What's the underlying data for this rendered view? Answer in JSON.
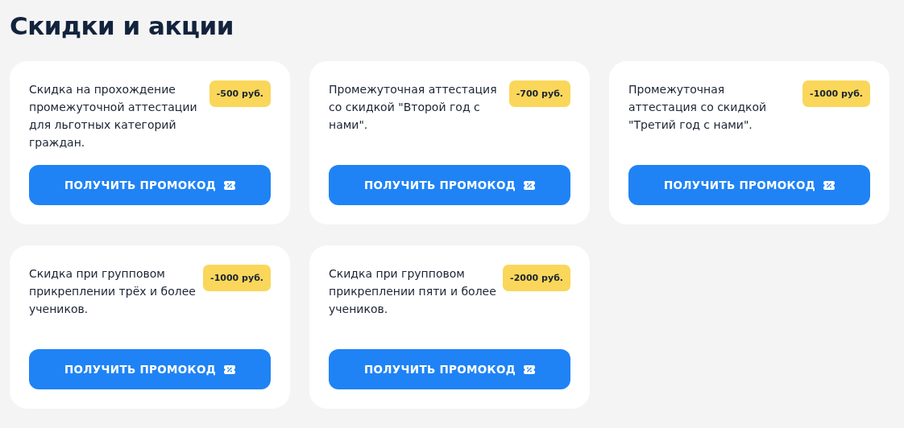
{
  "title": "Скидки и акции",
  "offers": [
    {
      "description": "Скидка на прохождение промежуточной аттестации для льготных категорий граждан.",
      "discount": "-500 руб.",
      "button": "ПОЛУЧИТЬ ПРОМОКОД"
    },
    {
      "description": "Промежуточная аттестация со скидкой \"Второй год с нами\".",
      "discount": "-700 руб.",
      "button": "ПОЛУЧИТЬ ПРОМОКОД"
    },
    {
      "description": "Промежуточная аттестация со скидкой \"Третий год с нами\".",
      "discount": "-1000 руб.",
      "button": "ПОЛУЧИТЬ ПРОМОКОД"
    },
    {
      "description": "Скидка при групповом прикреплении трёх и более учеников.",
      "discount": "-1000 руб.",
      "button": "ПОЛУЧИТЬ ПРОМОКОД"
    },
    {
      "description": "Скидка при групповом прикреплении пяти и более учеников.",
      "discount": "-2000 руб.",
      "button": "ПОЛУЧИТЬ ПРОМОКОД"
    }
  ]
}
